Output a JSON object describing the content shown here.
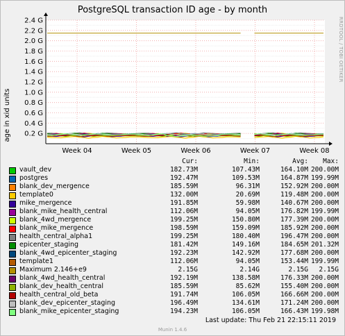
{
  "title": "PostgreSQL transaction ID age - by month",
  "watermark": "RRDTOOL / TOBI OETIKER",
  "legend_headers": {
    "cur": "Cur:",
    "min": "Min:",
    "avg": "Avg:",
    "max": "Max:"
  },
  "last_update": "Last update:  Thu Feb 21 22:15:11 2019",
  "footer": "Munin 1.4.6",
  "chart_data": {
    "type": "line",
    "title": "PostgreSQL transaction ID age - by month",
    "ylabel": "age in xid units",
    "xlabel": "",
    "ylim": [
      0,
      2.4
    ],
    "yticks": [
      0.2,
      0.4,
      0.6,
      0.8,
      1.0,
      1.2,
      1.4,
      1.6,
      1.8,
      2.0,
      2.2,
      2.4
    ],
    "ytick_labels": [
      "0.2 G",
      "0.4 G",
      "0.6 G",
      "0.8 G",
      "1.0 G",
      "1.2 G",
      "1.4 G",
      "1.6 G",
      "1.8 G",
      "2.0 G",
      "2.2 G",
      "2.4 G"
    ],
    "xticks": [
      "Week 04",
      "Week 05",
      "Week 06",
      "Week 07",
      "Week 08"
    ],
    "grid": true,
    "legend_position": "bottom",
    "series": [
      {
        "name": "vault_dev",
        "color": "#00cc00",
        "cur": "182.73M",
        "min": "107.43M",
        "avg": "164.10M",
        "max": "200.00M",
        "level": 0.17
      },
      {
        "name": "postgres",
        "color": "#0066b3",
        "cur": "192.47M",
        "min": "109.53M",
        "avg": "164.87M",
        "max": "199.99M",
        "level": 0.172
      },
      {
        "name": "blank_dev_mergence",
        "color": "#ff8000",
        "cur": "185.59M",
        "min": "96.31M",
        "avg": "152.92M",
        "max": "200.00M",
        "level": 0.16
      },
      {
        "name": "template0",
        "color": "#ffcc00",
        "cur": "132.00M",
        "min": "20.69M",
        "avg": "119.48M",
        "max": "200.00M",
        "level": 0.125
      },
      {
        "name": "mike_mergence",
        "color": "#330099",
        "cur": "191.85M",
        "min": "59.98M",
        "avg": "140.67M",
        "max": "200.00M",
        "level": 0.15
      },
      {
        "name": "blank_mike_health_central",
        "color": "#990099",
        "cur": "112.06M",
        "min": "94.05M",
        "avg": "176.82M",
        "max": "199.99M",
        "level": 0.175
      },
      {
        "name": "blank_4wd_mergence",
        "color": "#ccff00",
        "cur": "199.25M",
        "min": "150.80M",
        "avg": "177.39M",
        "max": "200.00M",
        "level": 0.185
      },
      {
        "name": "blank_mike_mergence",
        "color": "#ff0000",
        "cur": "198.59M",
        "min": "159.09M",
        "avg": "185.92M",
        "max": "200.00M",
        "level": 0.19
      },
      {
        "name": "health_central_alpha1",
        "color": "#808080",
        "cur": "199.25M",
        "min": "180.40M",
        "avg": "196.47M",
        "max": "200.00M",
        "level": 0.196
      },
      {
        "name": "epicenter_staging",
        "color": "#008f00",
        "cur": "181.42M",
        "min": "149.16M",
        "avg": "184.65M",
        "max": "201.32M",
        "level": 0.188
      },
      {
        "name": "blank_4wd_epicenter_staging",
        "color": "#00487d",
        "cur": "192.23M",
        "min": "142.92M",
        "avg": "177.68M",
        "max": "200.00M",
        "level": 0.182
      },
      {
        "name": "template1",
        "color": "#b35a00",
        "cur": "112.06M",
        "min": "94.05M",
        "avg": "153.44M",
        "max": "199.99M",
        "level": 0.155
      },
      {
        "name": "Maximum 2.146+e9",
        "color": "#b38f00",
        "cur": "2.15G",
        "min": "2.14G",
        "avg": "2.15G",
        "max": "2.15G",
        "level": 2.146
      },
      {
        "name": "blank_4wd_health_central",
        "color": "#6b006b",
        "cur": "192.19M",
        "min": "138.58M",
        "avg": "176.33M",
        "max": "200.00M",
        "level": 0.178
      },
      {
        "name": "blank_dev_health_central",
        "color": "#8fb300",
        "cur": "185.59M",
        "min": "85.62M",
        "avg": "155.40M",
        "max": "200.00M",
        "level": 0.158
      },
      {
        "name": "health_central_old_beta",
        "color": "#b30000",
        "cur": "191.74M",
        "min": "106.05M",
        "avg": "166.66M",
        "max": "200.00M",
        "level": 0.168
      },
      {
        "name": "blank_dev_epicenter_staging",
        "color": "#bebebe",
        "cur": "196.49M",
        "min": "134.61M",
        "avg": "171.24M",
        "max": "200.00M",
        "level": 0.18
      },
      {
        "name": "blank_mike_epicenter_staging",
        "color": "#80ff80",
        "cur": "194.23M",
        "min": "106.05M",
        "avg": "166.43M",
        "max": "199.98M",
        "level": 0.176
      }
    ]
  }
}
